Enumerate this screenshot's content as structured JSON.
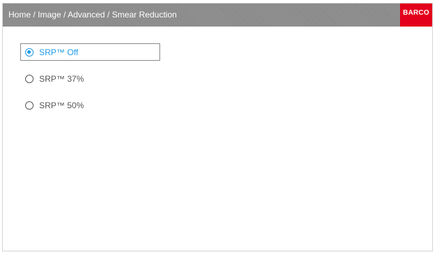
{
  "header": {
    "breadcrumb": "Home / Image / Advanced / Smear Reduction",
    "logo": "BARCO"
  },
  "options": [
    {
      "label": "SRP™ Off",
      "selected": true
    },
    {
      "label": "SRP™ 37%",
      "selected": false
    },
    {
      "label": "SRP™ 50%",
      "selected": false
    }
  ],
  "colors": {
    "header_bg": "#8e8e8e",
    "logo_bg": "#e3001b",
    "accent": "#1e9be6"
  }
}
